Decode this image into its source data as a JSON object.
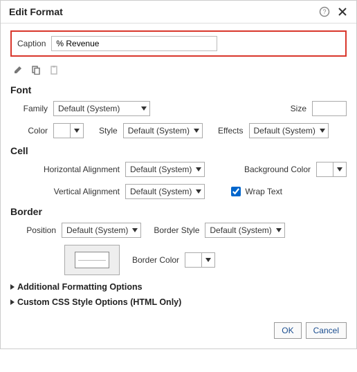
{
  "title": "Edit Format",
  "caption": {
    "label": "Caption",
    "value": "% Revenue"
  },
  "icons": {
    "help": "help-icon",
    "close": "close-icon",
    "pencil": "pencil-icon",
    "copy": "copy-icon",
    "paste": "paste-icon"
  },
  "sections": {
    "font": {
      "heading": "Font",
      "family": {
        "label": "Family",
        "value": "Default (System)"
      },
      "size": {
        "label": "Size",
        "value": ""
      },
      "color": {
        "label": "Color",
        "value": ""
      },
      "style": {
        "label": "Style",
        "value": "Default (System)"
      },
      "effects": {
        "label": "Effects",
        "value": "Default (System)"
      }
    },
    "cell": {
      "heading": "Cell",
      "halign": {
        "label": "Horizontal Alignment",
        "value": "Default (System)"
      },
      "bg": {
        "label": "Background Color"
      },
      "valign": {
        "label": "Vertical Alignment",
        "value": "Default (System)"
      },
      "wrap": {
        "label": "Wrap Text",
        "checked": true
      }
    },
    "border": {
      "heading": "Border",
      "position": {
        "label": "Position",
        "value": "Default (System)"
      },
      "style": {
        "label": "Border Style",
        "value": "Default (System)"
      },
      "color": {
        "label": "Border Color"
      }
    }
  },
  "expanders": {
    "additional": "Additional Formatting Options",
    "css": "Custom CSS Style Options (HTML Only)"
  },
  "footer": {
    "ok": "OK",
    "cancel": "Cancel"
  }
}
